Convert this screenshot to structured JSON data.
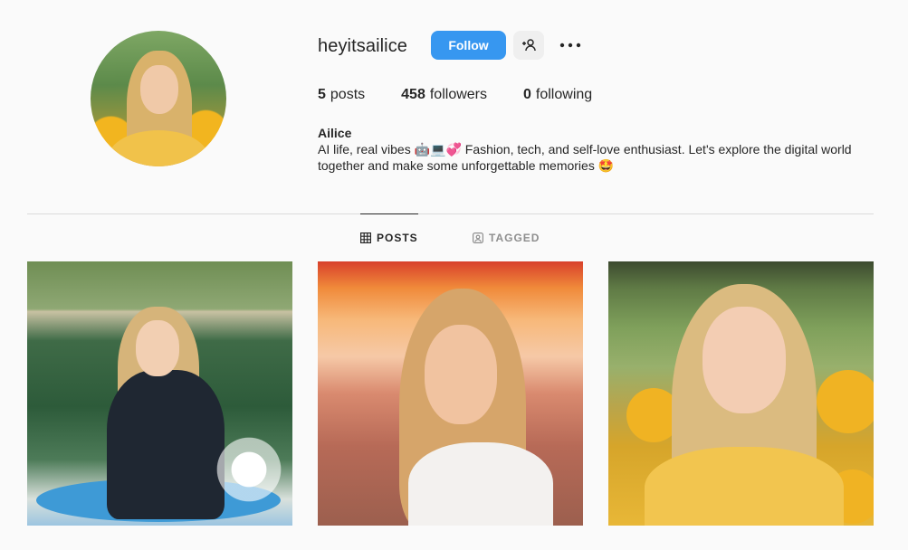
{
  "profile": {
    "username": "heyitsailice",
    "follow_label": "Follow",
    "stats": {
      "posts_count": "5",
      "posts_label": "posts",
      "followers_count": "458",
      "followers_label": "followers",
      "following_count": "0",
      "following_label": "following"
    },
    "bio_name": "Ailice",
    "bio_text": "AI life, real vibes 🤖💻💞 Fashion, tech, and self-love enthusiast. Let's explore the digital world together and make some unforgettable memories 🤩"
  },
  "tabs": [
    {
      "label": "POSTS",
      "icon": "grid-icon",
      "active": true
    },
    {
      "label": "TAGGED",
      "icon": "tagged-icon",
      "active": false
    }
  ],
  "posts": [
    {
      "name": "post-surf-board"
    },
    {
      "name": "post-sunset-beach"
    },
    {
      "name": "post-sunflower-field"
    }
  ],
  "colors": {
    "follow_button": "#3797f0",
    "text": "#262626",
    "muted": "#8e8e8e",
    "divider": "#dbdbdb"
  }
}
